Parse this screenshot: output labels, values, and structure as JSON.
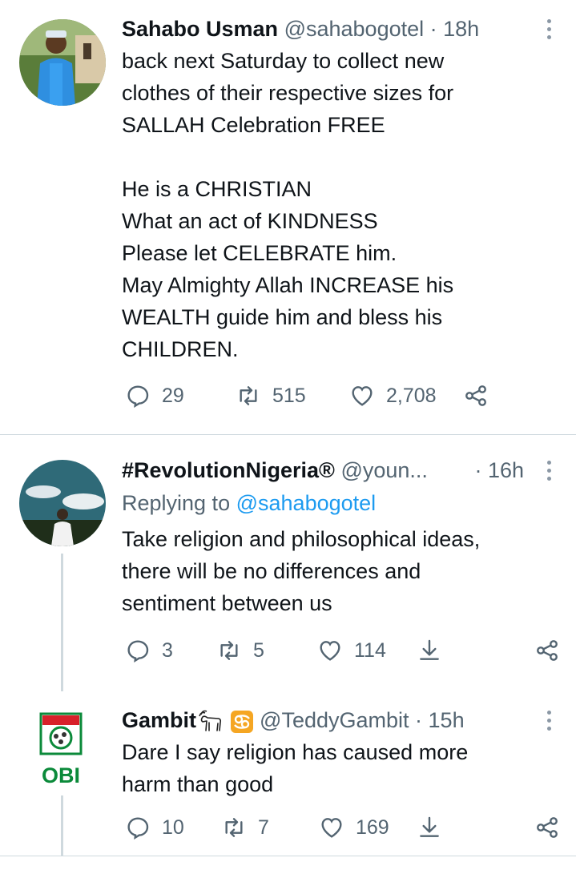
{
  "tweets": [
    {
      "name": "Sahabo Usman",
      "handle": "@sahabogotel",
      "time": "· 18h",
      "text": "back next Saturday to collect new\nclothes of their respective sizes for\nSALLAH Celebration FREE\n\nHe is a CHRISTIAN\nWhat an act of KINDNESS\nPlease let CELEBRATE him.\nMay Almighty Allah INCREASE his\nWEALTH guide him and bless his\nCHILDREN.",
      "replies": "29",
      "retweets": "515",
      "likes": "2,708"
    },
    {
      "name": "#RevolutionNigeria®",
      "handle": "@youn...",
      "time": "· 16h",
      "replying_prefix": "Replying to",
      "replying_to": "@sahabogotel",
      "text": "Take religion and philosophical ideas,\nthere will be no differences and\nsentiment between us",
      "replies": "3",
      "retweets": "5",
      "likes": "114"
    },
    {
      "name": "Gambit",
      "handle": "@TeddyGambit",
      "time": "· 15h",
      "avatar_text": "OBI",
      "text": "Dare I say religion has caused more\nharm than good",
      "replies": "10",
      "retweets": "7",
      "likes": "169"
    }
  ],
  "colors": {
    "accent": "#1d9bf0",
    "secondary": "#536471",
    "divider": "#cfd9de",
    "obi_green": "#0b8a3a",
    "obi_red": "#d8202a"
  },
  "icons": [
    "reply-icon",
    "retweet-icon",
    "like-icon",
    "share-icon",
    "more-icon",
    "goat-emoji-icon",
    "cancer-sign-icon"
  ]
}
